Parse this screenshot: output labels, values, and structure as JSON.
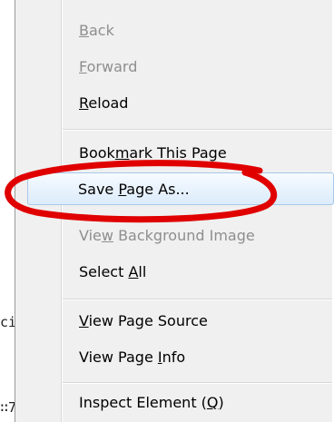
{
  "background_snippets": [
    "ci",
    "∷7"
  ],
  "menu": {
    "items": [
      {
        "key": "back",
        "before": "",
        "mnemonic": "B",
        "after": "ack",
        "disabled": true
      },
      {
        "key": "forward",
        "before": "",
        "mnemonic": "F",
        "after": "orward",
        "disabled": true
      },
      {
        "key": "reload",
        "before": "",
        "mnemonic": "R",
        "after": "eload",
        "disabled": false
      },
      {
        "key": "bookmark",
        "before": "Book",
        "mnemonic": "m",
        "after": "ark This Page",
        "disabled": false
      },
      {
        "key": "save-page-as",
        "before": "Save ",
        "mnemonic": "P",
        "after": "age As...",
        "disabled": false
      },
      {
        "key": "view-bg-image",
        "before": "Vie",
        "mnemonic": "w",
        "after": " Background Image",
        "disabled": true
      },
      {
        "key": "select-all",
        "before": "Select ",
        "mnemonic": "A",
        "after": "ll",
        "disabled": false
      },
      {
        "key": "view-source",
        "before": "",
        "mnemonic": "V",
        "after": "iew Page Source",
        "disabled": false
      },
      {
        "key": "view-info",
        "before": "View Page ",
        "mnemonic": "I",
        "after": "nfo",
        "disabled": false
      },
      {
        "key": "inspect",
        "before": "Inspect Element (",
        "mnemonic": "Q",
        "after": ")",
        "disabled": false
      }
    ]
  },
  "annotation": {
    "color": "#e00000"
  }
}
